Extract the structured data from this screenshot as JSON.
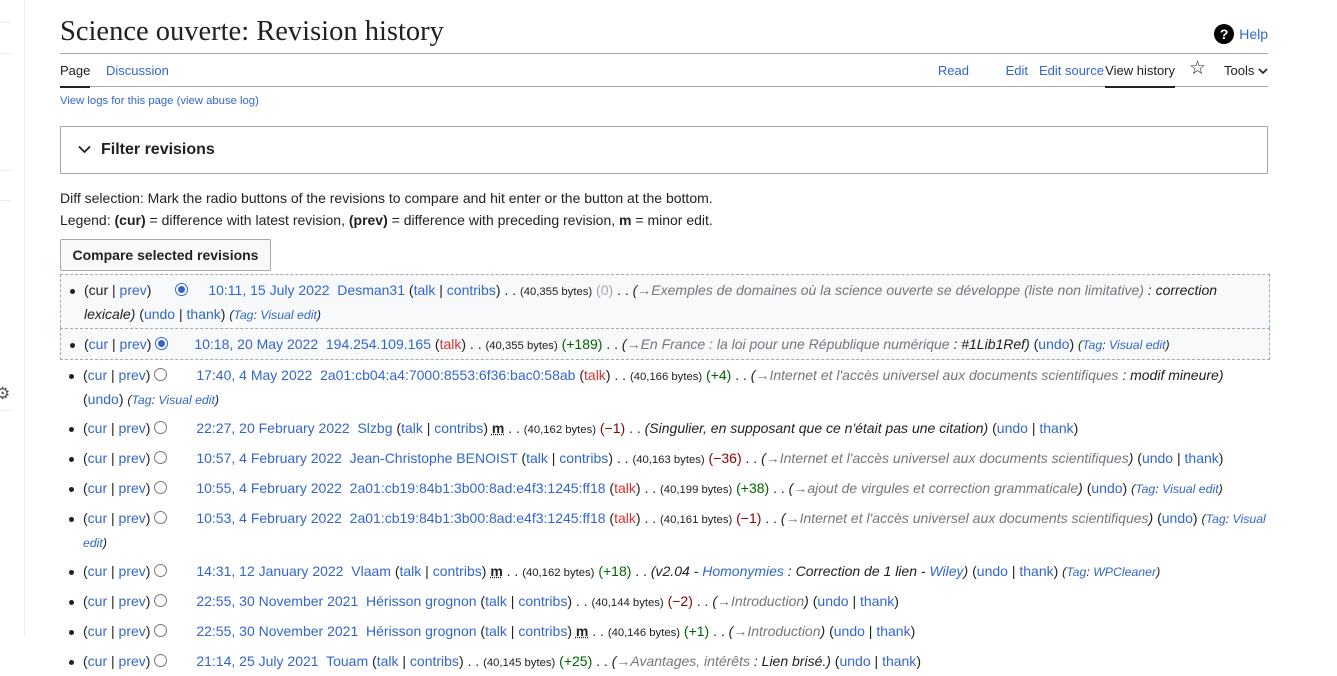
{
  "header": {
    "title": "Science ouverte: Revision history",
    "help": "Help"
  },
  "tabs": {
    "page": "Page",
    "discussion": "Discussion",
    "read": "Read",
    "edit": "Edit",
    "edit_source": "Edit source",
    "view_history": "View history",
    "tools": "Tools"
  },
  "icons": {
    "help": "help-icon",
    "star": "star-icon",
    "chevron": "chevron-down-icon",
    "gear": "gear-icon"
  },
  "sublinks": {
    "text": "View logs for this page (view abuse log)"
  },
  "filter": {
    "label": "Filter revisions"
  },
  "instructions": {
    "line1": "Diff selection: Mark the radio buttons of the revisions to compare and hit enter or the button at the bottom.",
    "legend_prefix": "Legend: ",
    "cur": "(cur)",
    "cur_desc": " = difference with latest revision, ",
    "prev": "(prev)",
    "prev_desc": " = difference with preceding revision, ",
    "m": "m",
    "m_desc": " = minor edit."
  },
  "compare_button": "Compare selected revisions",
  "common": {
    "cur": "cur",
    "prev": "prev",
    "talk": "talk",
    "contribs": "contribs",
    "undo": "undo",
    "thank": "thank",
    "m": "m",
    "tag_label": "Tag",
    "arrow": "→",
    "dots": ". .",
    "pipe": "|",
    "open": "(",
    "close": ")"
  },
  "revisions": [
    {
      "time": "10:11, 15 July 2022",
      "user": "Desman31",
      "bytes": "(40,355 bytes)",
      "delta": "(0)",
      "section": "Exemples de domaines où la science ouverte se développe (liste non limitative)",
      "comment": "correction lexicale",
      "tag": "Visual edit"
    },
    {
      "time": "10:18, 20 May 2022",
      "user": "194.254.109.165",
      "bytes": "(40,355 bytes)",
      "delta": "(+189)",
      "section": "En France : la loi pour une République numérique",
      "comment": "#1Lib1Ref",
      "tag": "Visual edit"
    },
    {
      "time": "17:40, 4 May 2022",
      "user": "2a01:cb04:a4:7000:8553:6f36:bac0:58ab",
      "bytes": "(40,166 bytes)",
      "delta": "(+4)",
      "section": "Internet et l'accès universel aux documents scientifiques",
      "comment": "modif mineure",
      "tag": "Visual edit"
    },
    {
      "time": "22:27, 20 February 2022",
      "user": "Slzbg",
      "bytes": "(40,162 bytes)",
      "delta": "(−1)",
      "summary": "(Singulier, en supposant que ce n'était pas une citation)"
    },
    {
      "time": "10:57, 4 February 2022",
      "user": "Jean-Christophe BENOIST",
      "bytes": "(40,163 bytes)",
      "delta": "(−36)",
      "section": "Internet et l'accès universel aux documents scientifiques"
    },
    {
      "time": "10:55, 4 February 2022",
      "user": "2a01:cb19:84b1:3b00:8ad:e4f3:1245:ff18",
      "bytes": "(40,199 bytes)",
      "delta": "(+38)",
      "section": "ajout de virgules et correction grammaticale",
      "tag": "Visual edit"
    },
    {
      "time": "10:53, 4 February 2022",
      "user": "2a01:cb19:84b1:3b00:8ad:e4f3:1245:ff18",
      "bytes": "(40,161 bytes)",
      "delta": "(−1)",
      "section": "Internet et l'accès universel aux documents scientifiques",
      "tag": "Visual edit"
    },
    {
      "time": "14:31, 12 January 2022",
      "user": "Vlaam",
      "bytes": "(40,162 bytes)",
      "delta": "(+18)",
      "s_pre": "(v2.04 - ",
      "s_link1": "Homonymies",
      "s_mid": " : Correction de 1 lien - ",
      "s_link2": "Wiley",
      "s_post": ")",
      "tag": "WPCleaner"
    },
    {
      "time": "22:55, 30 November 2021",
      "user": "Hérisson grognon",
      "bytes": "(40,144 bytes)",
      "delta": "(−2)",
      "section": "Introduction"
    },
    {
      "time": "22:55, 30 November 2021",
      "user": "Hérisson grognon",
      "bytes": "(40,146 bytes)",
      "delta": "(+1)",
      "section": "Introduction"
    },
    {
      "time": "21:14, 25 July 2021",
      "user": "Touam",
      "bytes": "(40,145 bytes)",
      "delta": "(+25)",
      "section": "Avantages, intérêts",
      "comment": "Lien brisé."
    }
  ]
}
